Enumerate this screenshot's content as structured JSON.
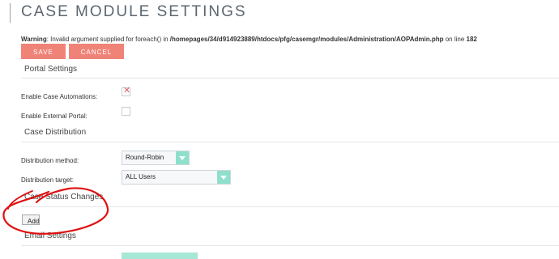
{
  "page": {
    "title": "CASE MODULE SETTINGS"
  },
  "warning": {
    "prefix": "Warning",
    "text": ": Invalid argument supplied for foreach() in ",
    "path": "/homepages/34/d914923889/htdocs/pfg/casemgr/modules/Administration/AOPAdmin.php",
    "line_text": " on line ",
    "line": "182"
  },
  "buttons": {
    "save": "SAVE",
    "cancel": "CANCEL",
    "add": "Add"
  },
  "sections": {
    "portal": "Portal Settings",
    "distribution": "Case Distribution",
    "status_changes": "Case Status Changes",
    "email": "Email Settings"
  },
  "fields": {
    "enable_case_automations": {
      "label": "Enable Case Automations:",
      "checked": true
    },
    "enable_external_portal": {
      "label": "Enable External Portal:",
      "checked": false
    },
    "distribution_method": {
      "label": "Distribution method:",
      "value": "Round-Robin"
    },
    "distribution_target": {
      "label": "Distribution target:",
      "value": "ALL Users"
    }
  },
  "colors": {
    "accent_button": "#f08377",
    "select_arrow": "#8ee0cc",
    "annotation": "#e01010"
  }
}
